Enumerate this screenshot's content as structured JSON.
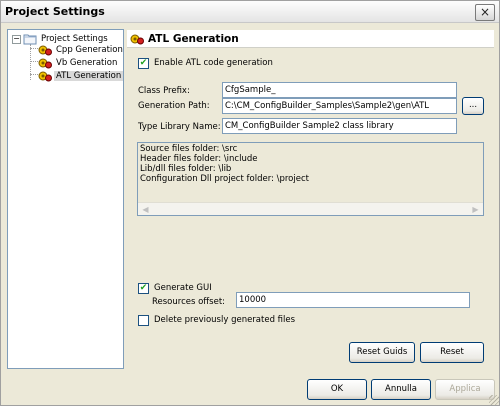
{
  "window": {
    "title": "Project Settings",
    "close_symbol": "×"
  },
  "tree": {
    "root": {
      "label": "Project Settings",
      "expander": "−"
    },
    "children": [
      {
        "label": "Cpp Generation"
      },
      {
        "label": "Vb Generation"
      },
      {
        "label": "ATL Generation"
      }
    ]
  },
  "panel": {
    "title": "ATL Generation",
    "enable_label": "Enable ATL code generation",
    "class_prefix": {
      "label": "Class Prefix:",
      "value": "CfgSample_"
    },
    "generation_path": {
      "label": "Generation Path:",
      "value": "C:\\CM_ConfigBuilder_Samples\\Sample2\\gen\\ATL",
      "browse_label": "..."
    },
    "type_library": {
      "label": "Type Library Name:",
      "value": "CM_ConfigBuilder Sample2 class library"
    },
    "info_lines": [
      "Source files folder: \\src",
      "Header files folder: \\include",
      "Lib/dll files folder: \\lib",
      "Configuration Dll project folder: \\project"
    ],
    "generate_gui_label": "Generate GUI",
    "resources_offset": {
      "label": "Resources offset:",
      "value": "10000"
    },
    "delete_label": "Delete previously generated files",
    "reset_guids_label": "Reset Guids",
    "reset_label": "Reset"
  },
  "footer": {
    "ok_label": "OK",
    "cancel_label": "Annulla",
    "apply_label": "Applica"
  }
}
